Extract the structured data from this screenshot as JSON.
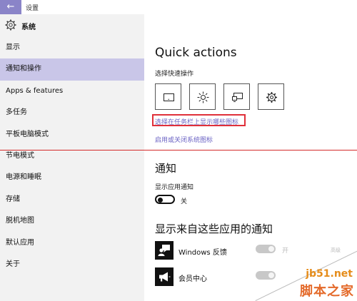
{
  "titlebar": {
    "back_glyph": "←",
    "title": "设置"
  },
  "sidebar": {
    "header": {
      "icon": "gear-icon",
      "title": "系统"
    },
    "items": [
      {
        "label": "显示",
        "active": false
      },
      {
        "label": "通知和操作",
        "active": true
      },
      {
        "label": "Apps & features",
        "active": false
      },
      {
        "label": "多任务",
        "active": false
      },
      {
        "label": "平板电脑模式",
        "active": false
      },
      {
        "label": "节电模式",
        "active": false
      },
      {
        "label": "电源和睡眠",
        "active": false
      },
      {
        "label": "存储",
        "active": false
      },
      {
        "label": "脱机地图",
        "active": false
      },
      {
        "label": "默认应用",
        "active": false
      },
      {
        "label": "关于",
        "active": false
      }
    ]
  },
  "quick_actions": {
    "title": "Quick actions",
    "subtitle": "选择快速操作",
    "tiles": [
      "tablet-mode-icon",
      "brightness-icon",
      "project-icon",
      "settings-icon"
    ],
    "link_taskbar_icons": "选择在任务栏上显示哪些图标",
    "link_system_icons": "启用或关闭系统图标"
  },
  "notifications": {
    "title": "通知",
    "subtitle": "显示应用通知",
    "toggle_label": "关"
  },
  "apps": {
    "title": "显示来自这些应用的通知",
    "items": [
      {
        "name": "Windows 反馈",
        "icon": "feedback-icon",
        "toggle_label": "开",
        "priority": "高级"
      },
      {
        "name": "会员中心",
        "icon": "megaphone-icon",
        "toggle_label": "",
        "priority": ""
      }
    ]
  },
  "watermark": {
    "site": "jb51.net",
    "name": "脚本之家"
  },
  "colors": {
    "accent": "#8a84c8",
    "selected_nav": "#c9c6e8",
    "link": "#6b63c4",
    "highlight_box": "#e0303a"
  }
}
